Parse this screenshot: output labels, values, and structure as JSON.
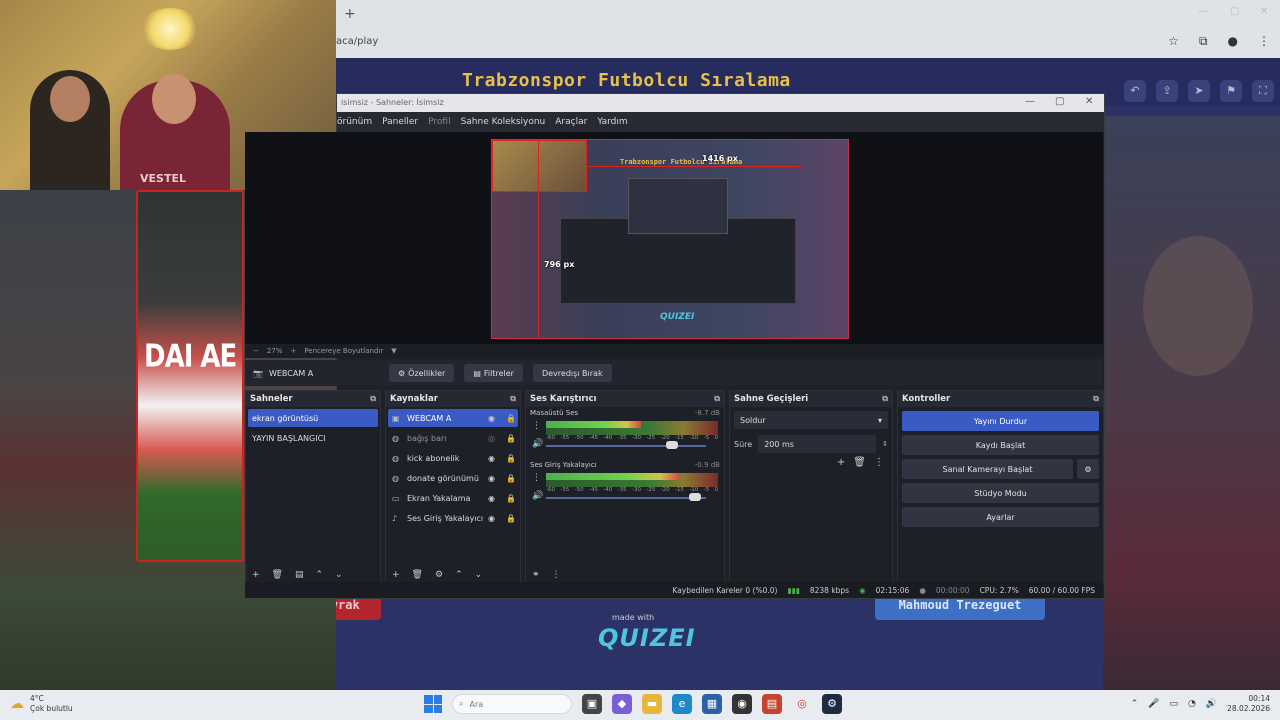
{
  "browser": {
    "new_tab": "+",
    "url": "aca/play",
    "icons": [
      "star-icon",
      "extension-icon",
      "profile-icon",
      "menu-icon"
    ]
  },
  "site": {
    "title": "Trabzonspor Futbolcu Sıralama",
    "tools": [
      "undo-icon",
      "share-icon",
      "send-icon",
      "flag-icon",
      "fullscreen-icon"
    ],
    "left_player": "Onur Kıvrak",
    "right_player": "Mahmoud Trezeguet",
    "made_with": "made with",
    "logo": "QUIZEI"
  },
  "webcam": {
    "shirt_text": "VESTEL"
  },
  "left_strip": {
    "board_text": "DAI AE"
  },
  "obs": {
    "title": "isimsiz - Sahneler: İsimsiz",
    "menu": [
      {
        "label": "örünüm",
        "dim": false
      },
      {
        "label": "Paneller",
        "dim": false
      },
      {
        "label": "Profil",
        "dim": true
      },
      {
        "label": "Sahne Koleksiyonu",
        "dim": false
      },
      {
        "label": "Araçlar",
        "dim": false
      },
      {
        "label": "Yardım",
        "dim": false
      }
    ],
    "preview": {
      "title": "Trabzonspor Futbolcu Sıralama",
      "width_label": "1416 px",
      "height_label": "796 px",
      "logo": "QUIZEI"
    },
    "zoom": {
      "minus": "−",
      "value": "27%",
      "plus": "+",
      "fit_label": "Pencereye Boyutlandır",
      "dropdown": "▼"
    },
    "source_bar": {
      "source_name": "WEBCAM A",
      "properties": "Özellikler",
      "filters": "Filtreler",
      "deactivate": "Devredışı Bırak"
    },
    "scenes": {
      "title": "Sahneler",
      "items": [
        {
          "label": "ekran görüntüsü",
          "selected": true
        },
        {
          "label": "YAYIN BAŞLANGICI",
          "selected": false
        }
      ]
    },
    "sources": {
      "title": "Kaynaklar",
      "items": [
        {
          "label": "WEBCAM A",
          "icon": "camera-icon",
          "selected": true,
          "visible": true
        },
        {
          "label": "bağış barı",
          "icon": "browser-icon",
          "selected": false,
          "visible": false
        },
        {
          "label": "kick abonelik",
          "icon": "browser-icon",
          "selected": false,
          "visible": true
        },
        {
          "label": "donate görünümü",
          "icon": "browser-icon",
          "selected": false,
          "visible": true
        },
        {
          "label": "Ekran Yakalama",
          "icon": "monitor-icon",
          "selected": false,
          "visible": true
        },
        {
          "label": "Ses Giriş Yakalayıcı",
          "icon": "mic-icon",
          "selected": false,
          "visible": true
        }
      ]
    },
    "mixer": {
      "title": "Ses Karıştırıcı",
      "ticks": [
        "-60",
        "-55",
        "-50",
        "-45",
        "-40",
        "-35",
        "-30",
        "-25",
        "-20",
        "-15",
        "-10",
        "-5",
        "0"
      ],
      "channels": [
        {
          "name": "Masaüstü Ses",
          "db": "-8.7 dB",
          "level": 0.55,
          "volume": 0.8
        },
        {
          "name": "Ses Giriş Yakalayıcı",
          "db": "-0.9 dB",
          "level": 0.78,
          "volume": 0.95
        }
      ]
    },
    "transitions": {
      "title": "Sahne Geçişleri",
      "selected": "Soldur",
      "duration_label": "Süre",
      "duration_value": "200 ms"
    },
    "controls": {
      "title": "Kontroller",
      "stop_stream": "Yayını Durdur",
      "start_record": "Kaydı Başlat",
      "virtual_cam": "Sanal Kamerayı Başlat",
      "studio_mode": "Stüdyo Modu",
      "settings": "Ayarlar"
    },
    "status": {
      "dropped_frames": "Kaybedilen Kareler 0 (%0.0)",
      "bitrate": "8238 kbps",
      "stream_time": "02:15:06",
      "record_time": "00:00:00",
      "cpu": "CPU: 2.7%",
      "fps": "60.00 / 60.00 FPS"
    }
  },
  "taskbar": {
    "temp": "4°C",
    "weather": "Çok bulutlu",
    "search": "Ara",
    "time": "00:14",
    "date": "28.02.2026"
  },
  "colors": {
    "obs_accent": "#3b5bc4",
    "site_title": "#e8c04a",
    "left_name_bg": "#b3262e",
    "right_name_bg": "#3d6fc4"
  }
}
